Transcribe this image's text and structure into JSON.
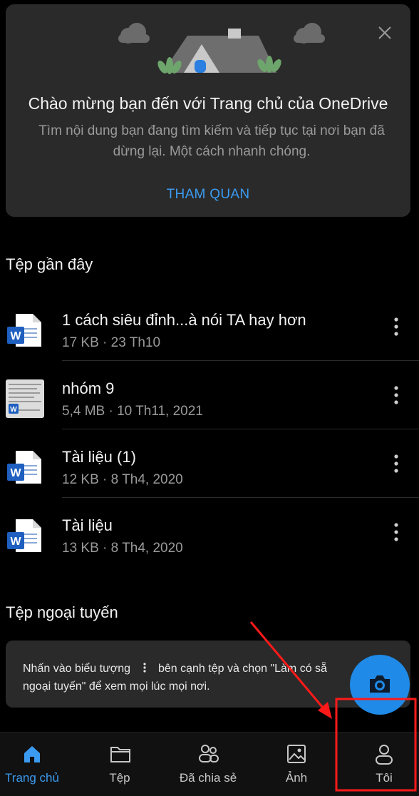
{
  "welcome": {
    "title": "Chào mừng bạn đến với Trang chủ của OneDrive",
    "description": "Tìm nội dung bạn đang tìm kiếm và tiếp tục tại nơi bạn đã dừng lại. Một cách nhanh chóng.",
    "tour_label": "THAM QUAN",
    "close_icon": "close-icon"
  },
  "recent": {
    "title": "Tệp gần đây",
    "files": [
      {
        "name": "1 cách siêu đỉnh...à nói TA hay hơn",
        "meta": "17 KB · 23 Th10",
        "icon": "word-doc-icon"
      },
      {
        "name": "nhóm 9",
        "meta": "5,4 MB · 10 Th11, 2021",
        "icon": "word-doc-thumbnail"
      },
      {
        "name": "Tài liệu (1)",
        "meta": "12 KB · 8 Th4, 2020",
        "icon": "word-doc-icon"
      },
      {
        "name": "Tài liệu",
        "meta": "13 KB · 8 Th4, 2020",
        "icon": "word-doc-icon"
      }
    ]
  },
  "offline": {
    "title": "Tệp ngoại tuyến",
    "hint_part1": "Nhấn vào biểu tượng",
    "hint_part2": "bên cạnh tệp và chọn \"Làm có sẵ",
    "hint_line2": "ngoại tuyến\" để xem mọi lúc mọi nơi."
  },
  "fab": {
    "icon": "camera-icon"
  },
  "nav": {
    "items": [
      {
        "label": "Trang chủ",
        "icon": "home-icon",
        "active": true
      },
      {
        "label": "Tệp",
        "icon": "folder-icon",
        "active": false
      },
      {
        "label": "Đã chia sẻ",
        "icon": "people-icon",
        "active": false
      },
      {
        "label": "Ảnh",
        "icon": "photo-icon",
        "active": false
      },
      {
        "label": "Tôi",
        "icon": "person-icon",
        "active": false
      }
    ]
  },
  "colors": {
    "accent": "#3b9bf0",
    "background": "#000000",
    "card": "#2a2a2a",
    "annotation": "#ff1a1a"
  }
}
